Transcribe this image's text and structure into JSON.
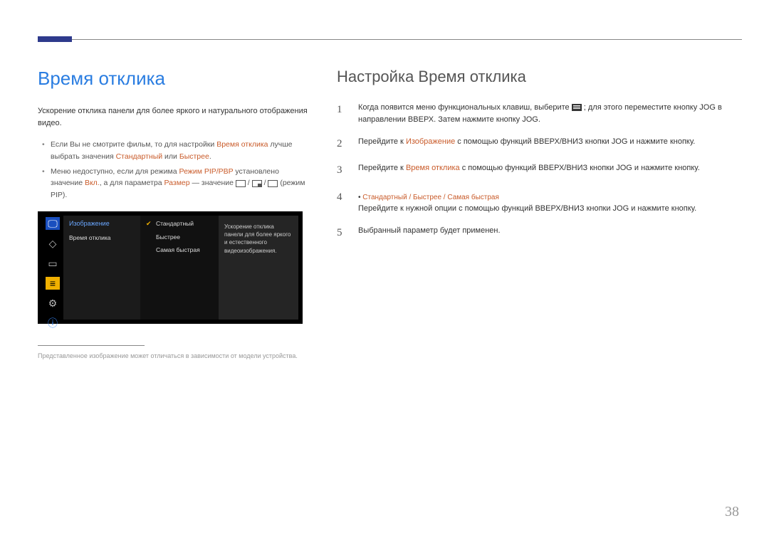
{
  "page_number": "38",
  "left": {
    "heading": "Время отклика",
    "intro": "Ускорение отклика панели для более яркого и натурального отображения видео.",
    "bullet1_a": "Если Вы не смотрите фильм, то для настройки ",
    "bullet1_hl1": "Время отклика",
    "bullet1_b": " лучше выбрать значения ",
    "bullet1_hl2": "Стандартный",
    "bullet1_c": " или ",
    "bullet1_hl3": "Быстрее",
    "bullet1_d": ".",
    "bullet2_a": "Меню недоступно, если для режима ",
    "bullet2_hl1": "Режим PIP/PBP",
    "bullet2_b": " установлено значение ",
    "bullet2_hl2": "Вкл.",
    "bullet2_c": ", а для параметра ",
    "bullet2_hl3": "Размер",
    "bullet2_d": " — значение ",
    "bullet2_e": " (режим PIP).",
    "footnote": "Представленное изображение может отличаться в зависимости от модели устройства."
  },
  "osd": {
    "section": "Изображение",
    "item": "Время отклика",
    "opt1": "Стандартный",
    "opt2": "Быстрее",
    "opt3": "Самая быстрая",
    "desc": "Ускорение отклика панели для более яркого и естественного видеоизображения."
  },
  "right": {
    "heading": "Настройка Время отклика",
    "step1": "Когда появится меню функциональных клавиш, выберите ",
    "step1b": " ; для этого переместите кнопку JOG в направлении ВВЕРХ. Затем нажмите кнопку JOG.",
    "step2a": "Перейдите к ",
    "step2hl": "Изображение",
    "step2b": " с помощью функций ВВЕРХ/ВНИЗ кнопки JOG и нажмите кнопку.",
    "step3a": "Перейдите к ",
    "step3hl": "Время отклика",
    "step3b": " с помощью функций ВВЕРХ/ВНИЗ кнопки JOG и нажмите кнопку.",
    "step4sub_a": "• ",
    "step4sub_hl": "Стандартный / Быстрее / Самая быстрая",
    "step4": "Перейдите к нужной опции с помощью функций ВВЕРХ/ВНИЗ кнопки JOG и нажмите кнопку.",
    "step5": "Выбранный параметр будет применен."
  }
}
